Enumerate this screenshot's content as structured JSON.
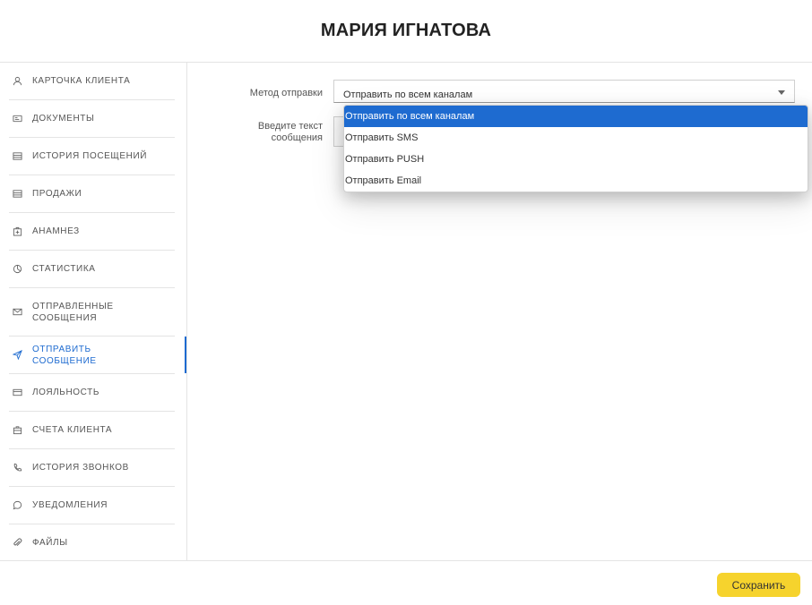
{
  "header": {
    "title": "МАРИЯ ИГНАТОВА"
  },
  "sidebar": {
    "items": [
      {
        "label": "КАРТОЧКА КЛИЕНТА",
        "icon": "user-icon"
      },
      {
        "label": "ДОКУМЕНТЫ",
        "icon": "id-card-icon"
      },
      {
        "label": "ИСТОРИЯ ПОСЕЩЕНИЙ",
        "icon": "list-icon"
      },
      {
        "label": "ПРОДАЖИ",
        "icon": "list-icon"
      },
      {
        "label": "АНАМНЕЗ",
        "icon": "medical-kit-icon"
      },
      {
        "label": "СТАТИСТИКА",
        "icon": "pie-chart-icon"
      },
      {
        "label": "ОТПРАВЛЕННЫЕ СООБЩЕНИЯ",
        "icon": "envelope-icon"
      },
      {
        "label": "ОТПРАВИТЬ СООБЩЕНИЕ",
        "icon": "send-icon",
        "active": true
      },
      {
        "label": "ЛОЯЛЬНОСТЬ",
        "icon": "card-icon"
      },
      {
        "label": "СЧЕТА КЛИЕНТА",
        "icon": "briefcase-icon"
      },
      {
        "label": "ИСТОРИЯ ЗВОНКОВ",
        "icon": "phone-icon"
      },
      {
        "label": "УВЕДОМЛЕНИЯ",
        "icon": "chat-bubble-icon"
      },
      {
        "label": "ФАЙЛЫ",
        "icon": "paperclip-icon"
      }
    ],
    "active_color": "#1e6bd0"
  },
  "form": {
    "method_label": "Метод отправки",
    "method_value": "Отправить по всем каналам",
    "message_label": "Введите текст сообщения",
    "method_options": [
      "Отправить по всем каналам",
      "Отправить SMS",
      "Отправить PUSH",
      "Отправить Email"
    ],
    "selected_option_index": 0
  },
  "footer": {
    "save_label": "Сохранить",
    "save_color": "#f6d32d"
  }
}
